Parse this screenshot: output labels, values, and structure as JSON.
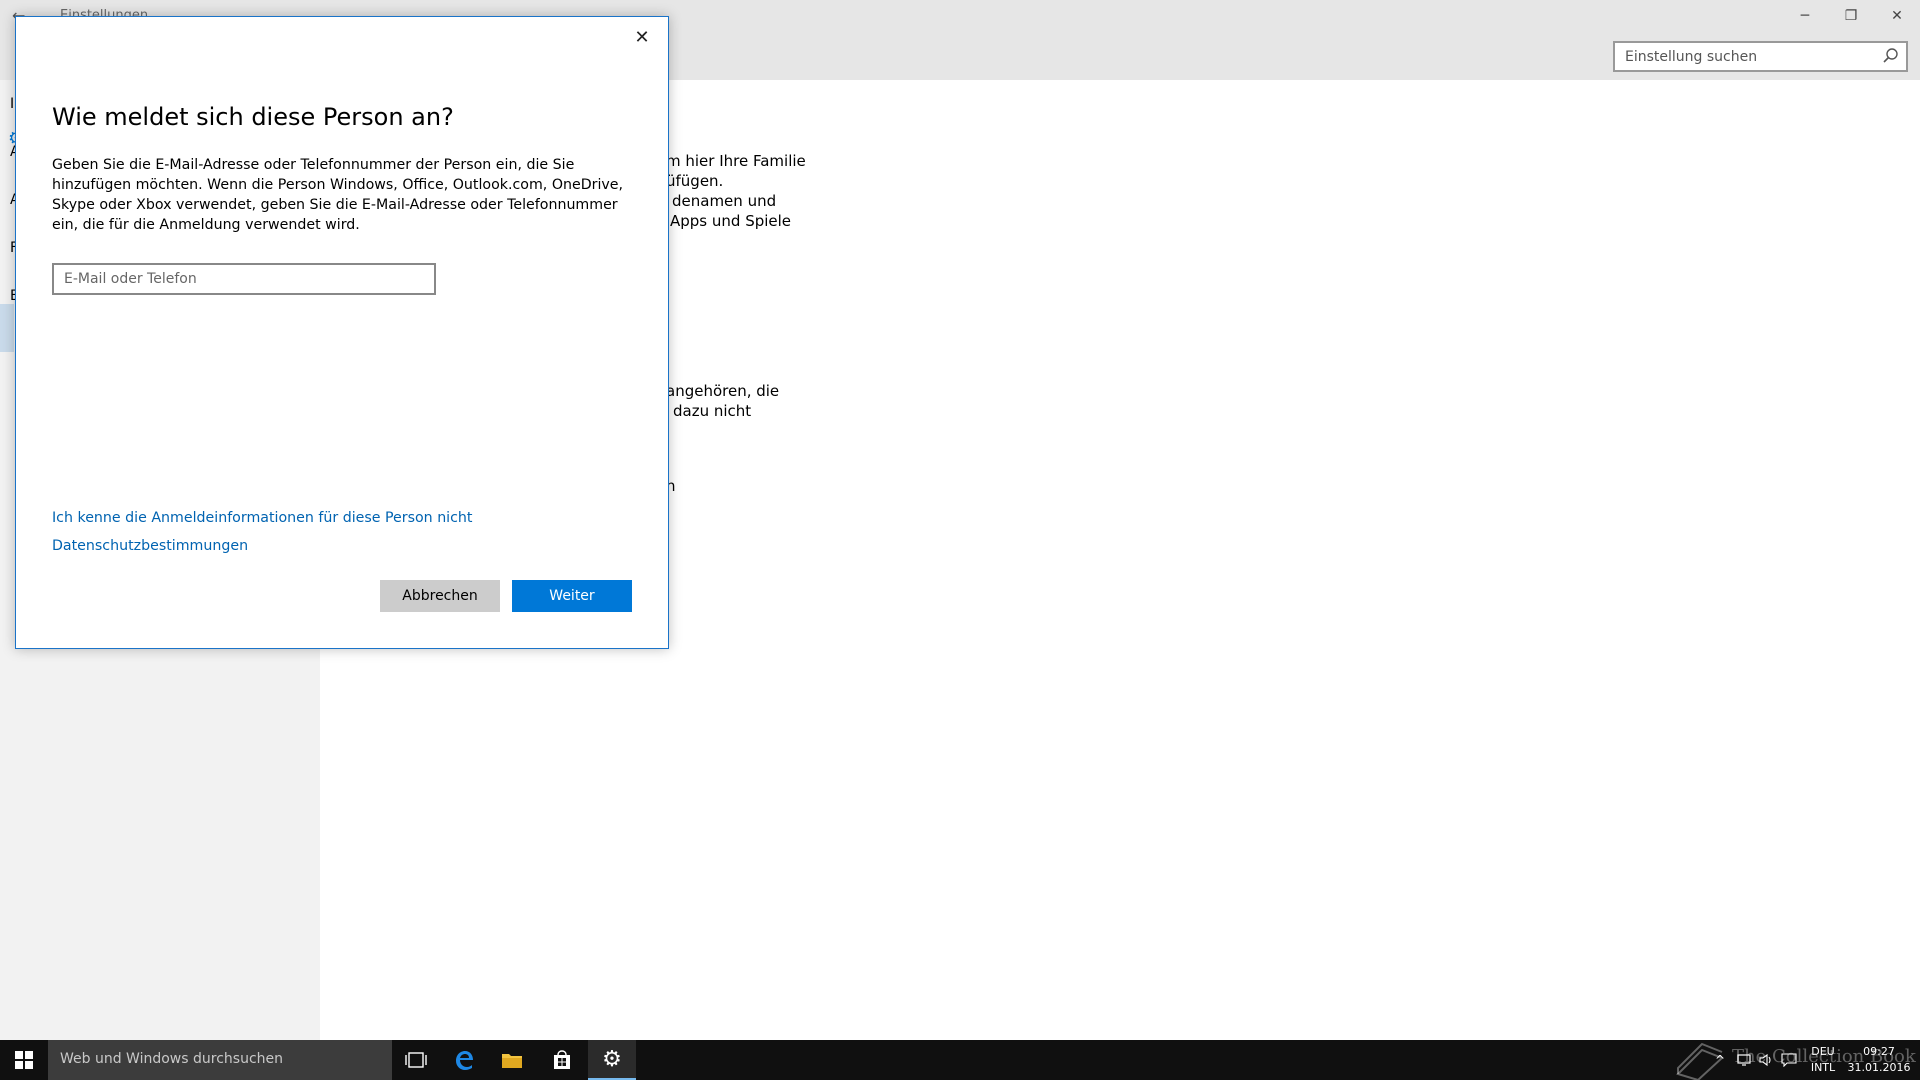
{
  "window": {
    "title": "Einstellungen",
    "back": "←",
    "minimize": "─",
    "restore": "❐",
    "close": "✕"
  },
  "search": {
    "placeholder": "Einstellung suchen"
  },
  "sidebar": {
    "items": [
      "I",
      "A",
      "A",
      "F",
      "E"
    ]
  },
  "main": {
    "para1": [
      "m hier Ihre Familie",
      "üfügen.",
      "denamen und",
      "Apps und Spiele"
    ],
    "para2": [
      "angehören, die",
      "dazu nicht"
    ],
    "para3": "n"
  },
  "dialog": {
    "close": "✕",
    "title": "Wie meldet sich diese Person an?",
    "description": "Geben Sie die E-Mail-Adresse oder Telefonnummer der Person ein, die Sie hinzufügen möchten. Wenn die Person Windows, Office, Outlook.com, OneDrive, Skype oder Xbox verwendet, geben Sie die E-Mail-Adresse oder Telefonnummer ein, die für die Anmeldung verwendet wird.",
    "input_placeholder": "E-Mail oder Telefon",
    "link_no_info": "Ich kenne die Anmeldeinformationen für diese Person nicht",
    "link_privacy": "Datenschutzbestimmungen",
    "cancel_label": "Abbrechen",
    "next_label": "Weiter"
  },
  "taskbar": {
    "search_text": "Web und Windows durchsuchen",
    "icons": [
      "task-view-icon",
      "edge-icon",
      "file-explorer-icon",
      "store-icon",
      "settings-icon"
    ],
    "tray_up": "^",
    "lang_top": "DEU",
    "lang_bottom": "INTL",
    "time": "09:27",
    "date": "31.01.2016",
    "watermark": "The Collection Book"
  },
  "colors": {
    "accent": "#0078d7",
    "link": "#0063b1",
    "taskbar": "#101010"
  }
}
